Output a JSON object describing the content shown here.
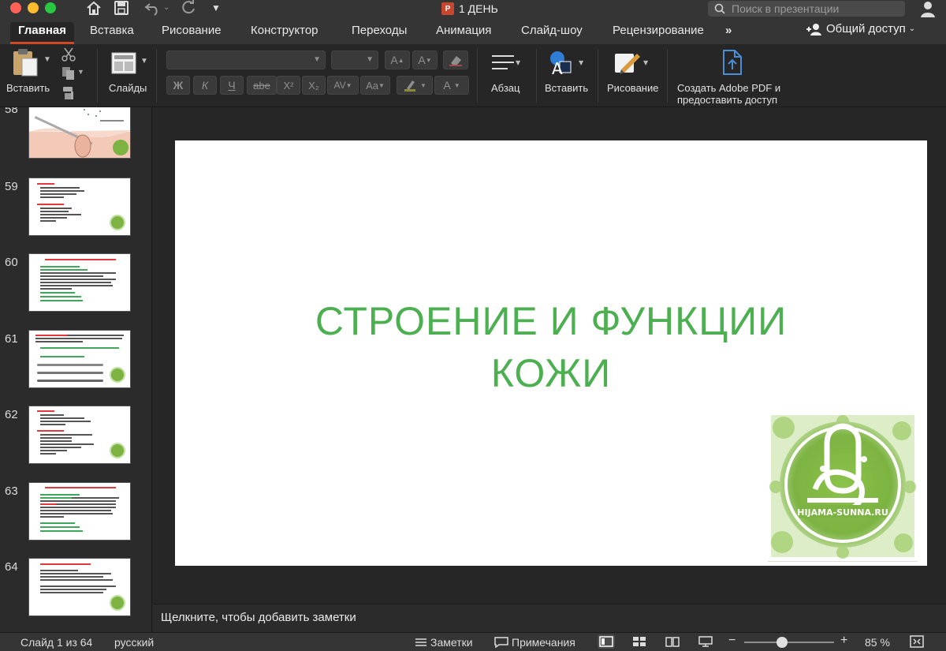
{
  "window": {
    "title": "1 ДЕНЬ",
    "search_placeholder": "Поиск в презентации"
  },
  "tabs": [
    {
      "label": "Главная",
      "active": true
    },
    {
      "label": "Вставка"
    },
    {
      "label": "Рисование"
    },
    {
      "label": "Конструктор"
    },
    {
      "label": "Переходы"
    },
    {
      "label": "Анимация"
    },
    {
      "label": "Слайд-шоу"
    },
    {
      "label": "Рецензирование"
    }
  ],
  "tabs_more": "»",
  "share_label": "Общий доступ",
  "ribbon": {
    "paste_label": "Вставить",
    "slides_label": "Слайды",
    "paragraph_label": "Абзац",
    "insert_label": "Вставить",
    "drawing_label": "Рисование",
    "adobe_label_line1": "Создать Adobe PDF и",
    "adobe_label_line2": "предоставить доступ",
    "font_buttons": {
      "bold": "Ж",
      "italic": "К",
      "underline": "Ч",
      "strike": "abe",
      "superscript": "X²",
      "subscript": "X₂",
      "spacing": "AV",
      "case": "Aa",
      "grow": "A",
      "shrink": "A",
      "font_color": "A"
    }
  },
  "slides_panel": [
    {
      "number": "58"
    },
    {
      "number": "59"
    },
    {
      "number": "60"
    },
    {
      "number": "61"
    },
    {
      "number": "62"
    },
    {
      "number": "63"
    },
    {
      "number": "64"
    }
  ],
  "slide": {
    "title_line1": "СТРОЕНИЕ И ФУНКЦИИ",
    "title_line2": "КОЖИ",
    "logo_text": "HIJAMA-SUNNA.RU"
  },
  "notes_placeholder": "Щелкните, чтобы добавить заметки",
  "status": {
    "slide_counter": "Слайд 1 из 64",
    "language": "русский",
    "notes_label": "Заметки",
    "comments_label": "Примечания",
    "zoom_value": "85 %"
  },
  "colors": {
    "title_green": "#4caf50",
    "accent": "#d24726",
    "logo_green": "#7cb342"
  }
}
